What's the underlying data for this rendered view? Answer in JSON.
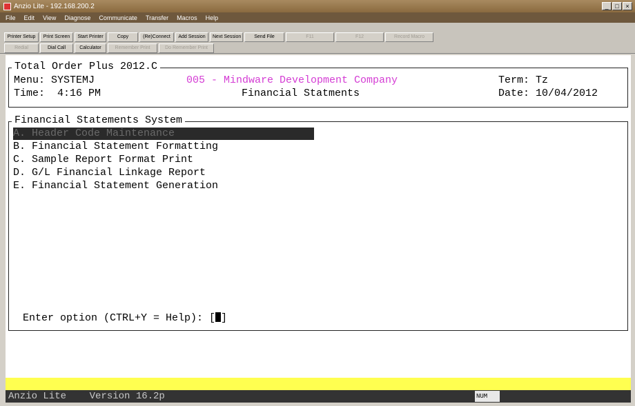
{
  "window": {
    "title": "Anzio Lite - 192.168.200.2"
  },
  "menubar": [
    "File",
    "Edit",
    "View",
    "Diagnose",
    "Communicate",
    "Transfer",
    "Macros",
    "Help"
  ],
  "toolbar": {
    "row1": [
      "Printer Setup",
      "Print Screen",
      "Start Printer",
      "Copy",
      "(Re)Connect",
      "Add Session",
      "Next Session",
      "Send File",
      "F11",
      "F12",
      "Record Macro"
    ],
    "row2": [
      "Redial",
      "Dial Call",
      "Calculator",
      "Remember Print",
      "Do Remember Print"
    ]
  },
  "header": {
    "title": "Total Order Plus 2012.C",
    "menu": "Menu: SYSTEMJ",
    "company": "005 - Mindware Development Company",
    "term": "Term: Tz",
    "time": "Time:  4:16 PM",
    "screen": "Financial Statments",
    "date": "Date: 10/04/2012"
  },
  "main": {
    "title": "Financial Statements System",
    "items": [
      "A. Header Code Maintenance",
      "B. Financial Statement Formatting",
      "C. Sample Report Format Print",
      "D. G/L Financial Linkage Report",
      "E. Financial Statement Generation"
    ],
    "prompt": "Enter option (CTRL+Y = Help): [",
    "prompt_end": "]"
  },
  "status": {
    "app": "Anzio Lite    Version 16.2p",
    "num": "NUM"
  }
}
